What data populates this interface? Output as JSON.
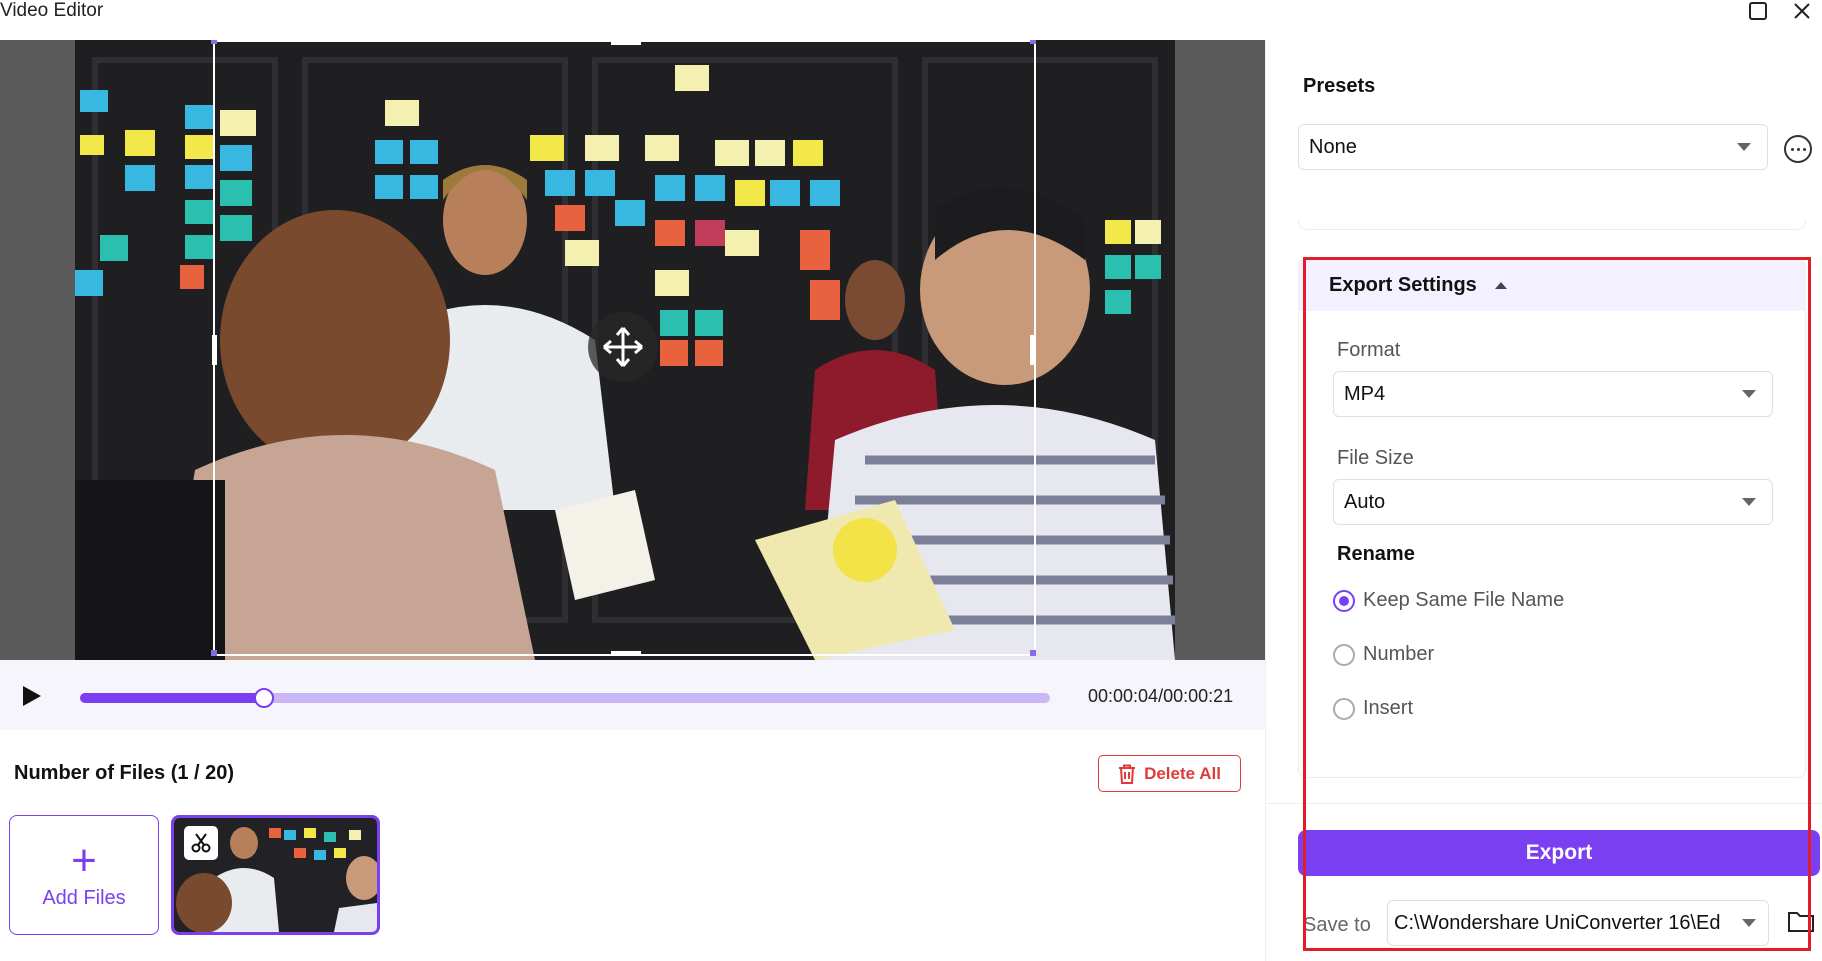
{
  "window": {
    "title": "Video Editor"
  },
  "player": {
    "time": "00:00:04/00:00:21",
    "progress": 0.19
  },
  "files": {
    "header": "Number of Files (1 / 20)",
    "delete_all_label": "Delete All",
    "add_files_label": "Add Files",
    "add_files_plus": "+"
  },
  "presets": {
    "label": "Presets",
    "value": "None"
  },
  "export_settings": {
    "title": "Export Settings",
    "format_label": "Format",
    "format_value": "MP4",
    "file_size_label": "File Size",
    "file_size_value": "Auto",
    "rename_label": "Rename",
    "options": [
      "Keep Same File Name",
      "Number",
      "Insert"
    ],
    "selected_option": "Keep Same File Name"
  },
  "export": {
    "button_label": "Export",
    "save_to_label": "Save to",
    "save_path": "C:\\Wondershare UniConverter 16\\Ed"
  },
  "colors": {
    "accent": "#7b3ff2",
    "danger": "#e03a3a",
    "highlight": "#e01e2a"
  }
}
